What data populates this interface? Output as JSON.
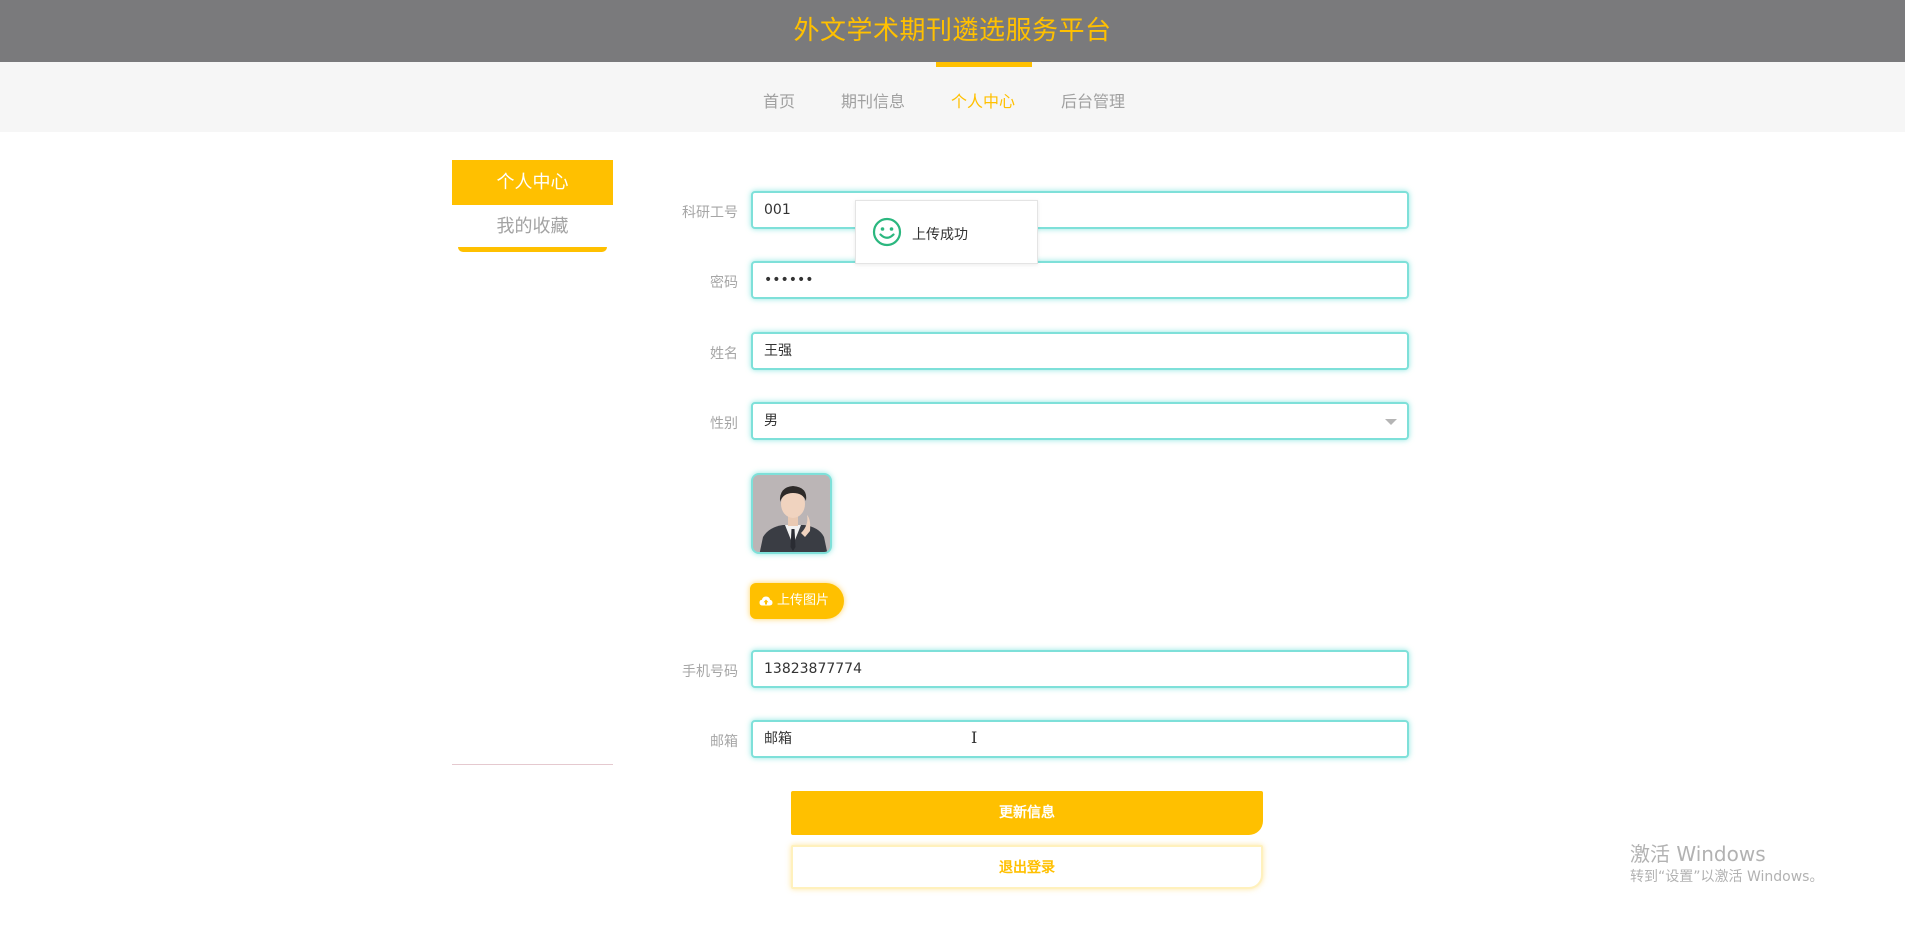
{
  "header": {
    "title": "外文学术期刊遴选服务平台"
  },
  "nav": {
    "items": [
      {
        "label": "首页",
        "active": false
      },
      {
        "label": "期刊信息",
        "active": false
      },
      {
        "label": "个人中心",
        "active": true
      },
      {
        "label": "后台管理",
        "active": false
      }
    ]
  },
  "sidebar": {
    "items": [
      {
        "label": "个人中心",
        "active": true
      },
      {
        "label": "我的收藏",
        "active": false
      }
    ]
  },
  "form": {
    "research_id": {
      "label": "科研工号",
      "value": "001"
    },
    "password": {
      "label": "密码",
      "value": "••••••"
    },
    "name": {
      "label": "姓名",
      "value": "王强"
    },
    "gender": {
      "label": "性别",
      "value": "男"
    },
    "upload_label": "上传图片",
    "phone": {
      "label": "手机号码",
      "value": "13823877774"
    },
    "email": {
      "label": "邮箱",
      "value": "邮箱"
    }
  },
  "actions": {
    "update": "更新信息",
    "logout": "退出登录"
  },
  "toast": {
    "message": "上传成功",
    "icon": "smile-icon"
  },
  "watermark": {
    "line1": "激活 Windows",
    "line2": "转到“设置”以激活 Windows。"
  },
  "colors": {
    "accent": "#ffc000",
    "topbar": "#7a7a7c",
    "input_border": "#7ee0d9"
  }
}
